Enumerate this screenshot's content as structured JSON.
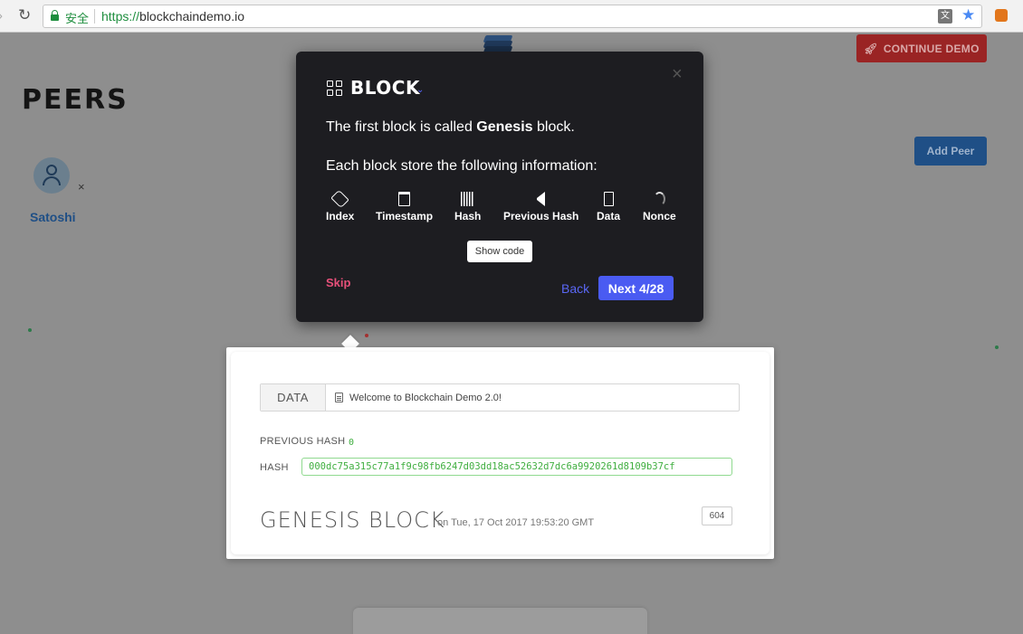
{
  "browser": {
    "secure_label": "安全",
    "url_scheme": "https://",
    "url_host": "blockchaindemo.io",
    "reload_icon": "reload-icon",
    "star_icon": "bookmark-star-icon"
  },
  "page": {
    "continue_demo": "CONTINUE DEMO",
    "peers_title": "PEERS",
    "add_peer": "Add Peer",
    "peer": {
      "name": "Satoshi",
      "remove": "×"
    }
  },
  "block": {
    "data_label": "DATA",
    "data_value": "Welcome to Blockchain Demo 2.0!",
    "previous_hash_label": "PREVIOUS HASH",
    "previous_hash_value": "0",
    "hash_label": "HASH",
    "hash_value": "000dc75a315c77a1f9c98fb6247d03dd18ac52632d7dc6a9920261d8109b37cf",
    "title": "GENESIS BLOCK",
    "date": "on Tue, 17 Oct 2017 19:53:20 GMT",
    "nonce": "604"
  },
  "tour": {
    "title": "BLOCK",
    "line1_pre": "The first block is called ",
    "line1_bold": "Genesis",
    "line1_post": " block.",
    "line2": "Each block store the following information:",
    "fields": [
      "Index",
      "Timestamp",
      "Hash",
      "Previous Hash",
      "Data",
      "Nonce"
    ],
    "show_code": "Show code",
    "skip": "Skip",
    "back": "Back",
    "next": "Next 4/28",
    "close": "×"
  },
  "colors": {
    "accent": "#4a5bf2",
    "skip": "#e8507a",
    "hash_green": "#3fae3f",
    "continue_red": "#9a2424"
  }
}
